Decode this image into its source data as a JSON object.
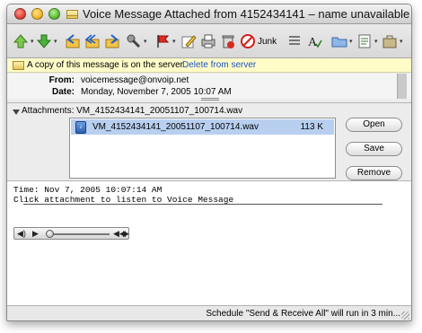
{
  "window": {
    "title": "Voice Message Attached from 4152434141 – name unavailable"
  },
  "toolbar": {
    "junk_label": "Junk",
    "buttons": [
      "previous",
      "next",
      "reply",
      "reply-all",
      "forward",
      "redirect",
      "flag",
      "compose",
      "print",
      "delete",
      "junk",
      "categories",
      "spelling",
      "folder",
      "view",
      "project"
    ]
  },
  "server_notice": {
    "message": "A copy of this message is on the server.",
    "link": "Delete from server"
  },
  "headers": {
    "from_label": "From:",
    "from_value": "voicemessage@onvoip.net",
    "date_label": "Date:",
    "date_value": "Monday, November 7, 2005 10:07 AM"
  },
  "attachments": {
    "label": "Attachments:",
    "summary": "VM_4152434141_20051107_100714.wav",
    "items": [
      {
        "name": "VM_4152434141_20051107_100714.wav",
        "size": "113 K"
      }
    ],
    "open_label": "Open",
    "save_label": "Save",
    "remove_label": "Remove"
  },
  "body": {
    "line1": "Time: Nov 7, 2005 10:07:14 AM",
    "line2": "Click attachment to listen to Voice Message"
  },
  "player": {
    "position": 0
  },
  "status": {
    "text": "Schedule \"Send & Receive All\" will run in 3 min..."
  },
  "colors": {
    "selection": "#b8cff0",
    "server_bar": "#fffcc8",
    "link": "#1a4fc4"
  }
}
